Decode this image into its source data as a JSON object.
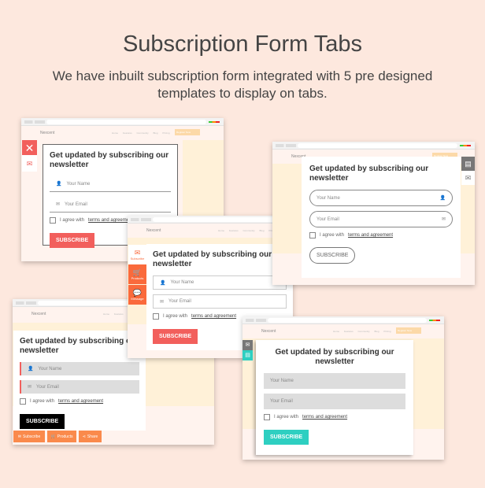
{
  "header": {
    "title": "Subscription Form Tabs",
    "subtitle": "We have inbuilt subscription form integrated with 5 pre designed templates to display on tabs."
  },
  "site": {
    "logo": "Nexcent",
    "links": "Home Features Community Blog Pricing",
    "register": "Register Now"
  },
  "form": {
    "heading": "Get updated by subscribing our newsletter",
    "name_placeholder": "Your Name",
    "email_placeholder": "Your Email",
    "agree": "I agree with",
    "terms": "terms and agreement",
    "subscribe": "SUBSCRIBE"
  },
  "tabs": {
    "subscribe": "Subscribe",
    "products": "Products",
    "message": "Message",
    "share": "Share"
  },
  "colors": {
    "background": "#fde8de",
    "red": "#f25f5c",
    "orange": "#fa6a3c",
    "teal": "#2ecfc1",
    "black": "#000000",
    "gray": "#777777"
  }
}
